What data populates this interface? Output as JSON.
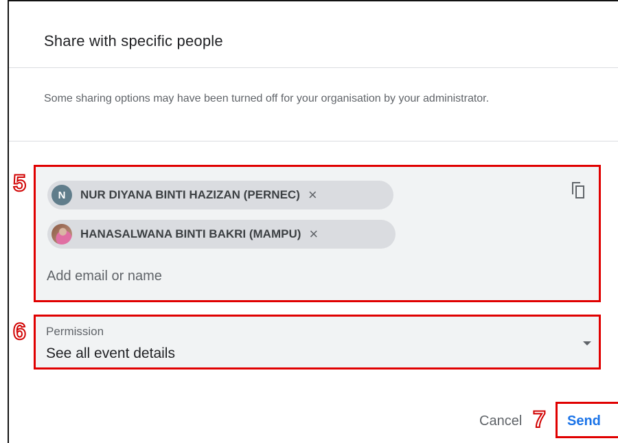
{
  "dialog": {
    "title": "Share with specific people",
    "notice": "Some sharing options may have been turned off for your organisation by your administrator."
  },
  "people": {
    "chips": [
      {
        "initial": "N",
        "label": "NUR DIYANA BINTI HAZIZAN (PERNEC)",
        "remove": "×"
      },
      {
        "label": "HANASALWANA BINTI BAKRI (MAMPU)",
        "remove": "×"
      }
    ],
    "input_placeholder": "Add email or name",
    "icons": {
      "copy": "copy-icon"
    }
  },
  "permission": {
    "label": "Permission",
    "value": "See all event details",
    "icon": "dropdown-arrow-icon"
  },
  "actions": {
    "cancel": "Cancel",
    "send": "Send"
  },
  "annotations": {
    "step5": "5",
    "step6": "6",
    "step7": "7"
  },
  "colors": {
    "highlight": "#e00000",
    "accent": "#1a73e8",
    "field_bg": "#f1f3f4",
    "chip_bg": "#dadce0",
    "avatar_n": "#607d8b"
  }
}
